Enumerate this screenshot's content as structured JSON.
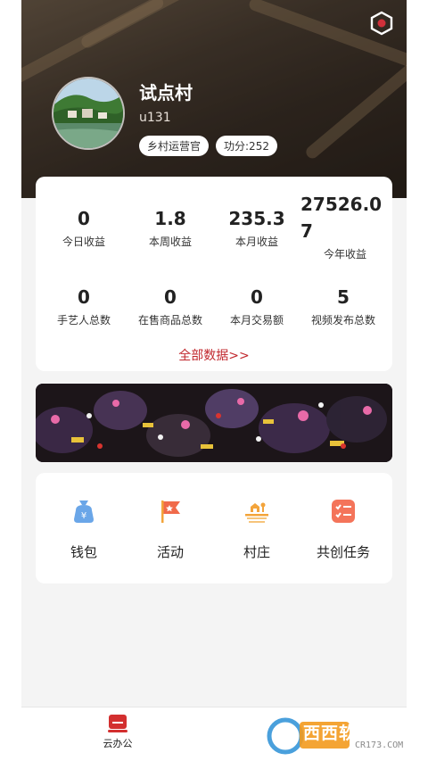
{
  "profile": {
    "name": "试点村",
    "uid": "u131",
    "role_tag": "乡村运营官",
    "merit_tag": "功分:252"
  },
  "stats": [
    {
      "value": "0",
      "label": "今日收益"
    },
    {
      "value": "1.8",
      "label": "本周收益"
    },
    {
      "value": "235.3",
      "label": "本月收益"
    },
    {
      "value": "27526.0",
      "value2": "7",
      "label": "今年收益"
    },
    {
      "value": "0",
      "label": "手艺人总数"
    },
    {
      "value": "0",
      "label": "在售商品总数"
    },
    {
      "value": "0",
      "label": "本月交易额"
    },
    {
      "value": "5",
      "label": "视频发布总数"
    }
  ],
  "all_data_link": "全部数据>>",
  "menu": [
    {
      "label": "钱包",
      "icon": "wallet-bag-icon"
    },
    {
      "label": "活动",
      "icon": "activity-flag-icon"
    },
    {
      "label": "村庄",
      "icon": "village-icon"
    },
    {
      "label": "共创任务",
      "icon": "task-list-icon"
    }
  ],
  "tabbar": {
    "office_label": "云办公",
    "office_icon": "cloud-office-icon"
  },
  "watermark": {
    "brand": "西西软件园",
    "domain": "CR173.COM"
  },
  "colors": {
    "accent_red": "#c1272d",
    "icon_orange": "#f3a43b",
    "icon_blue": "#6aa6e8"
  }
}
